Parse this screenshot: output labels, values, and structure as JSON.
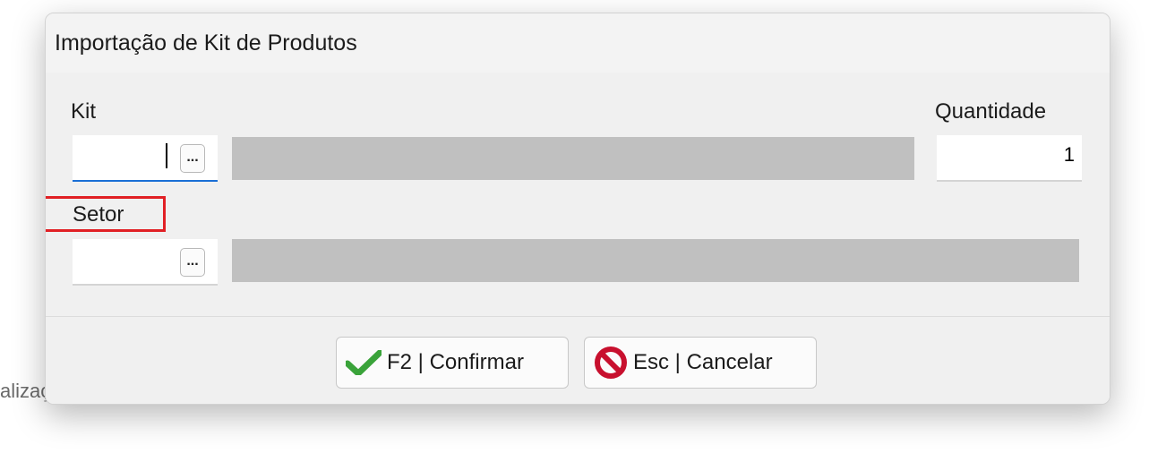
{
  "background": {
    "partial_text": "alizaçãoP"
  },
  "dialog": {
    "title": "Importação de Kit de Produtos",
    "kit": {
      "label": "Kit",
      "code_value": "",
      "lookup_label": "...",
      "description": ""
    },
    "quantidade": {
      "label": "Quantidade",
      "value": "1"
    },
    "setor": {
      "label": "Setor",
      "code_value": "",
      "lookup_label": "...",
      "description": ""
    },
    "buttons": {
      "confirm_label": "F2 | Confirmar",
      "cancel_label": "Esc | Cancelar"
    }
  },
  "colors": {
    "focus_underline": "#1a6fd6",
    "highlight_box": "#e12025",
    "check_icon": "#3aa33a",
    "cancel_icon": "#c8102e",
    "readonly_field": "#c0c0c0"
  },
  "icons": {
    "confirm": "check-icon",
    "cancel": "no-entry-icon"
  }
}
